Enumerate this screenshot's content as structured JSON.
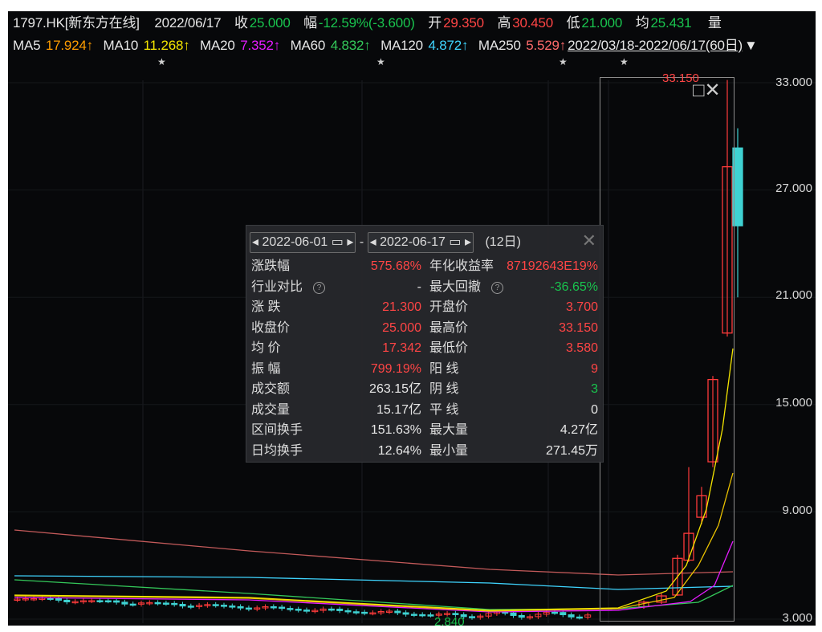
{
  "header": {
    "ticker": "1797.HK[新东方在线]",
    "date": "2022/06/17",
    "close_label": "收",
    "close_value": "25.000",
    "change_label": "幅",
    "change_value": "-12.59%(-3.600)",
    "open_label": "开",
    "open_value": "29.350",
    "high_label": "高",
    "high_value": "30.450",
    "low_label": "低",
    "low_value": "21.000",
    "avg_label": "均",
    "avg_value": "25.431",
    "volume_label": "量"
  },
  "ma": {
    "ma5_label": "MA5",
    "ma5_value": "17.924↑",
    "ma10_label": "MA10",
    "ma10_value": "11.268↑",
    "ma20_label": "MA20",
    "ma20_value": "7.352↑",
    "ma60_label": "MA60",
    "ma60_value": "4.832↑",
    "ma120_label": "MA120",
    "ma120_value": "4.872↑",
    "ma250_label": "MA250",
    "ma250_value": "5.529↑",
    "range_label": "2022/03/18-2022/06/17(60日)",
    "dropdown_glyph": "▼"
  },
  "y_axis": [
    "33.000",
    "27.000",
    "21.000",
    "15.000",
    "9.000",
    "3.000"
  ],
  "chart_labels": {
    "high_marker": "33.150",
    "low_marker": "2.840"
  },
  "panel": {
    "start_date": "2022-06-01",
    "end_date": "2022-06-17",
    "separator": "-",
    "span": "(12日)",
    "rows": [
      {
        "l1": "涨跌幅",
        "v1": "575.68%",
        "l2": "年化收益率",
        "v2": "87192643E19%",
        "c1": "red",
        "c2": "red"
      },
      {
        "l1": "行业对比",
        "v1": "-",
        "l2": "最大回撤",
        "v2": "-36.65%",
        "c1": "wht",
        "c2": "grn",
        "q1": true,
        "q2": true
      },
      {
        "l1": "涨  跌",
        "v1": "21.300",
        "l2": "开盘价",
        "v2": "3.700",
        "c1": "red",
        "c2": "red"
      },
      {
        "l1": "收盘价",
        "v1": "25.000",
        "l2": "最高价",
        "v2": "33.150",
        "c1": "red",
        "c2": "red"
      },
      {
        "l1": "均  价",
        "v1": "17.342",
        "l2": "最低价",
        "v2": "3.580",
        "c1": "red",
        "c2": "red"
      },
      {
        "l1": "振  幅",
        "v1": "799.19%",
        "l2": "阳  线",
        "v2": "9",
        "c1": "red",
        "c2": "red"
      },
      {
        "l1": "成交额",
        "v1": "263.15亿",
        "l2": "阴  线",
        "v2": "3",
        "c1": "wht",
        "c2": "grn"
      },
      {
        "l1": "成交量",
        "v1": "15.17亿",
        "l2": "平  线",
        "v2": "0",
        "c1": "wht",
        "c2": "wht"
      },
      {
        "l1": "区间换手",
        "v1": "151.63%",
        "l2": "最大量",
        "v2": "4.27亿",
        "c1": "wht",
        "c2": "wht"
      },
      {
        "l1": "日均换手",
        "v1": "12.64%",
        "l2": "最小量",
        "v2": "271.45万",
        "c1": "wht",
        "c2": "wht"
      }
    ]
  },
  "chart_data": {
    "type": "candlestick",
    "ylim": [
      3,
      33
    ],
    "y_ticks": [
      3,
      9,
      15,
      21,
      27,
      33
    ],
    "colors": {
      "up": "#ff3b3b",
      "down": "#3fd2d2",
      "ma5": "#f3e400",
      "ma10": "#e8c000",
      "ma20": "#e51cff",
      "ma60": "#34c85a",
      "ma120": "#3fd5ff",
      "ma250": "#c35a5a"
    },
    "recent_candles": [
      {
        "o": 3.7,
        "c": 3.95,
        "h": 4.05,
        "l": 3.58
      },
      {
        "o": 3.95,
        "c": 4.3,
        "h": 4.45,
        "l": 3.85
      },
      {
        "o": 4.35,
        "c": 6.4,
        "h": 6.6,
        "l": 4.3
      },
      {
        "o": 6.3,
        "c": 7.8,
        "h": 11.5,
        "l": 6.2
      },
      {
        "o": 8.7,
        "c": 9.9,
        "h": 10.4,
        "l": 8.3
      },
      {
        "o": 11.8,
        "c": 16.4,
        "h": 16.6,
        "l": 11.5
      },
      {
        "o": 19.0,
        "c": 28.3,
        "h": 33.15,
        "l": 18.8
      },
      {
        "o": 29.35,
        "c": 25.0,
        "h": 30.45,
        "l": 21.0
      }
    ]
  }
}
